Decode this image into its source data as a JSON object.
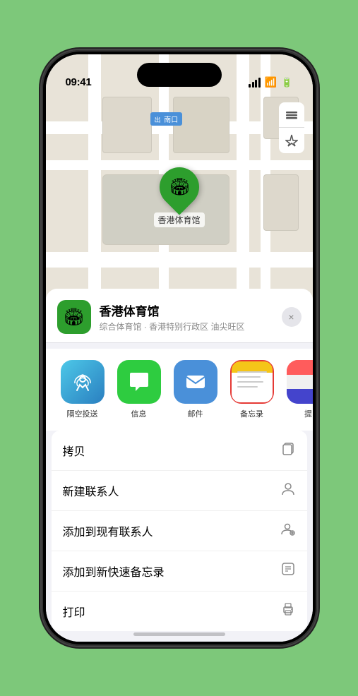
{
  "statusBar": {
    "time": "09:41",
    "location_arrow": "▶"
  },
  "mapLabel": "南口",
  "markerLabel": "香港体育馆",
  "mapControls": {
    "layers": "⊞",
    "location": "➤"
  },
  "sheet": {
    "venueName": "香港体育馆",
    "venueDesc": "综合体育馆 · 香港特别行政区 油尖旺区",
    "closeLabel": "×"
  },
  "shareItems": [
    {
      "id": "airdrop",
      "label": "隔空投送",
      "type": "airdrop"
    },
    {
      "id": "message",
      "label": "信息",
      "type": "message"
    },
    {
      "id": "mail",
      "label": "邮件",
      "type": "mail"
    },
    {
      "id": "notes",
      "label": "备忘录",
      "type": "notes"
    },
    {
      "id": "more",
      "label": "提",
      "type": "more"
    }
  ],
  "actionItems": [
    {
      "id": "copy",
      "label": "拷贝",
      "icon": "📋"
    },
    {
      "id": "new-contact",
      "label": "新建联系人",
      "icon": "👤"
    },
    {
      "id": "add-to-contact",
      "label": "添加到现有联系人",
      "icon": "👤"
    },
    {
      "id": "add-quick-note",
      "label": "添加到新快速备忘录",
      "icon": "🗒"
    },
    {
      "id": "print",
      "label": "打印",
      "icon": "🖨"
    }
  ],
  "homeIndicator": ""
}
